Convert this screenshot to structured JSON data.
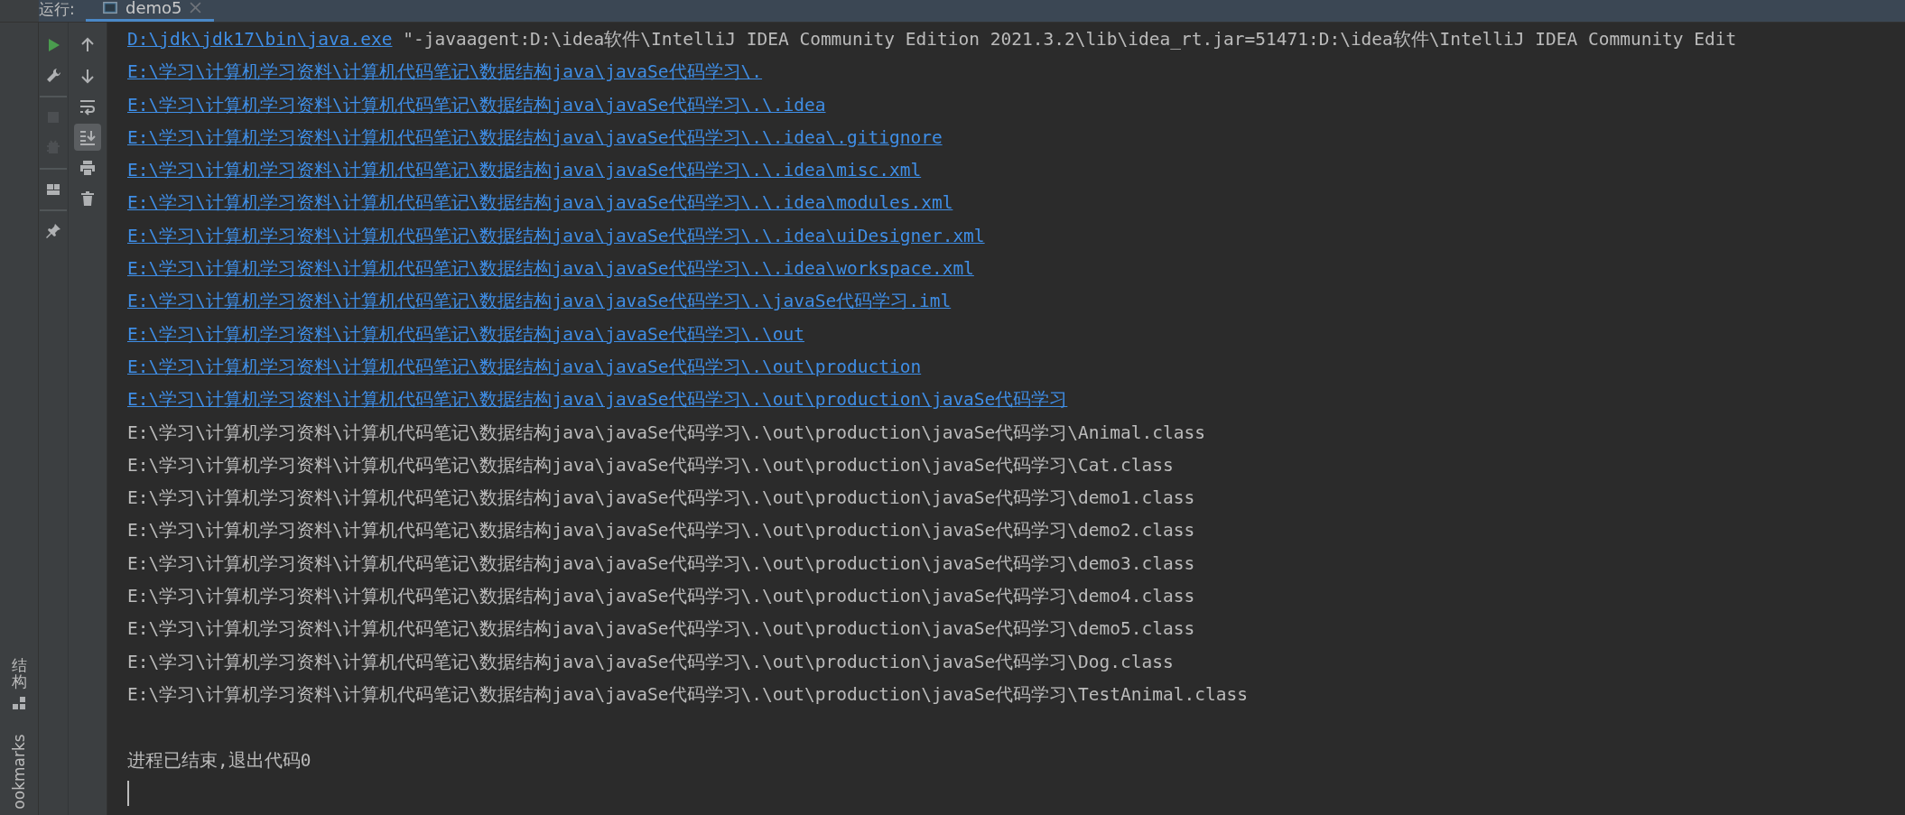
{
  "run_bar": {
    "label": "运行:",
    "tabs": [
      {
        "label": "demo5",
        "selected": true
      }
    ]
  },
  "side_stripe": {
    "items": [
      {
        "kind": "structure",
        "label": "结构"
      },
      {
        "kind": "bookmarks",
        "label": "ookmarks"
      }
    ]
  },
  "toolbar_left": [
    {
      "kind": "run",
      "disabled": false
    },
    {
      "kind": "wrench",
      "disabled": false
    },
    {
      "kind": "separator"
    },
    {
      "kind": "stop",
      "disabled": true
    },
    {
      "kind": "bug",
      "disabled": true
    },
    {
      "kind": "separator"
    },
    {
      "kind": "layout",
      "disabled": false
    },
    {
      "kind": "separator"
    },
    {
      "kind": "pin",
      "disabled": false
    }
  ],
  "toolbar_right": [
    {
      "kind": "up",
      "selected": false
    },
    {
      "kind": "down",
      "selected": false
    },
    {
      "kind": "wrap",
      "selected": false
    },
    {
      "kind": "scroll-end",
      "selected": true
    },
    {
      "kind": "print",
      "selected": false
    },
    {
      "kind": "trash",
      "selected": false
    }
  ],
  "console": {
    "lines": [
      {
        "segments": [
          {
            "text": "D:\\jdk\\jdk17\\bin\\java.exe",
            "link": true
          },
          {
            "text": " \"-javaagent:D:\\idea软件\\IntelliJ IDEA Community Edition 2021.3.2\\lib\\idea_rt.jar=51471:D:\\idea软件\\IntelliJ IDEA Community Edit",
            "link": false
          }
        ]
      },
      {
        "segments": [
          {
            "text": "E:\\学习\\计算机学习资料\\计算机代码笔记\\数据结构java\\javaSe代码学习\\.",
            "link": true
          }
        ]
      },
      {
        "segments": [
          {
            "text": "E:\\学习\\计算机学习资料\\计算机代码笔记\\数据结构java\\javaSe代码学习\\.\\.idea",
            "link": true
          }
        ]
      },
      {
        "segments": [
          {
            "text": "E:\\学习\\计算机学习资料\\计算机代码笔记\\数据结构java\\javaSe代码学习\\.\\.idea\\.gitignore",
            "link": true
          }
        ]
      },
      {
        "segments": [
          {
            "text": "E:\\学习\\计算机学习资料\\计算机代码笔记\\数据结构java\\javaSe代码学习\\.\\.idea\\misc.xml",
            "link": true
          }
        ]
      },
      {
        "segments": [
          {
            "text": "E:\\学习\\计算机学习资料\\计算机代码笔记\\数据结构java\\javaSe代码学习\\.\\.idea\\modules.xml",
            "link": true
          }
        ]
      },
      {
        "segments": [
          {
            "text": "E:\\学习\\计算机学习资料\\计算机代码笔记\\数据结构java\\javaSe代码学习\\.\\.idea\\uiDesigner.xml",
            "link": true
          }
        ]
      },
      {
        "segments": [
          {
            "text": "E:\\学习\\计算机学习资料\\计算机代码笔记\\数据结构java\\javaSe代码学习\\.\\.idea\\workspace.xml",
            "link": true
          }
        ]
      },
      {
        "segments": [
          {
            "text": "E:\\学习\\计算机学习资料\\计算机代码笔记\\数据结构java\\javaSe代码学习\\.\\javaSe代码学习.iml",
            "link": true
          }
        ]
      },
      {
        "segments": [
          {
            "text": "E:\\学习\\计算机学习资料\\计算机代码笔记\\数据结构java\\javaSe代码学习\\.\\out",
            "link": true
          }
        ]
      },
      {
        "segments": [
          {
            "text": "E:\\学习\\计算机学习资料\\计算机代码笔记\\数据结构java\\javaSe代码学习\\.\\out\\production",
            "link": true
          }
        ]
      },
      {
        "segments": [
          {
            "text": "E:\\学习\\计算机学习资料\\计算机代码笔记\\数据结构java\\javaSe代码学习\\.\\out\\production\\javaSe代码学习",
            "link": true
          }
        ]
      },
      {
        "segments": [
          {
            "text": "E:\\学习\\计算机学习资料\\计算机代码笔记\\数据结构java\\javaSe代码学习\\.\\out\\production\\javaSe代码学习\\Animal.class",
            "link": false
          }
        ]
      },
      {
        "segments": [
          {
            "text": "E:\\学习\\计算机学习资料\\计算机代码笔记\\数据结构java\\javaSe代码学习\\.\\out\\production\\javaSe代码学习\\Cat.class",
            "link": false
          }
        ]
      },
      {
        "segments": [
          {
            "text": "E:\\学习\\计算机学习资料\\计算机代码笔记\\数据结构java\\javaSe代码学习\\.\\out\\production\\javaSe代码学习\\demo1.class",
            "link": false
          }
        ]
      },
      {
        "segments": [
          {
            "text": "E:\\学习\\计算机学习资料\\计算机代码笔记\\数据结构java\\javaSe代码学习\\.\\out\\production\\javaSe代码学习\\demo2.class",
            "link": false
          }
        ]
      },
      {
        "segments": [
          {
            "text": "E:\\学习\\计算机学习资料\\计算机代码笔记\\数据结构java\\javaSe代码学习\\.\\out\\production\\javaSe代码学习\\demo3.class",
            "link": false
          }
        ]
      },
      {
        "segments": [
          {
            "text": "E:\\学习\\计算机学习资料\\计算机代码笔记\\数据结构java\\javaSe代码学习\\.\\out\\production\\javaSe代码学习\\demo4.class",
            "link": false
          }
        ]
      },
      {
        "segments": [
          {
            "text": "E:\\学习\\计算机学习资料\\计算机代码笔记\\数据结构java\\javaSe代码学习\\.\\out\\production\\javaSe代码学习\\demo5.class",
            "link": false
          }
        ]
      },
      {
        "segments": [
          {
            "text": "E:\\学习\\计算机学习资料\\计算机代码笔记\\数据结构java\\javaSe代码学习\\.\\out\\production\\javaSe代码学习\\Dog.class",
            "link": false
          }
        ]
      },
      {
        "segments": [
          {
            "text": "E:\\学习\\计算机学习资料\\计算机代码笔记\\数据结构java\\javaSe代码学习\\.\\out\\production\\javaSe代码学习\\TestAnimal.class",
            "link": false
          }
        ]
      },
      {
        "gap_before": true,
        "segments": [
          {
            "text": "进程已结束,退出代码0",
            "link": false
          }
        ]
      }
    ],
    "cursor": true
  }
}
